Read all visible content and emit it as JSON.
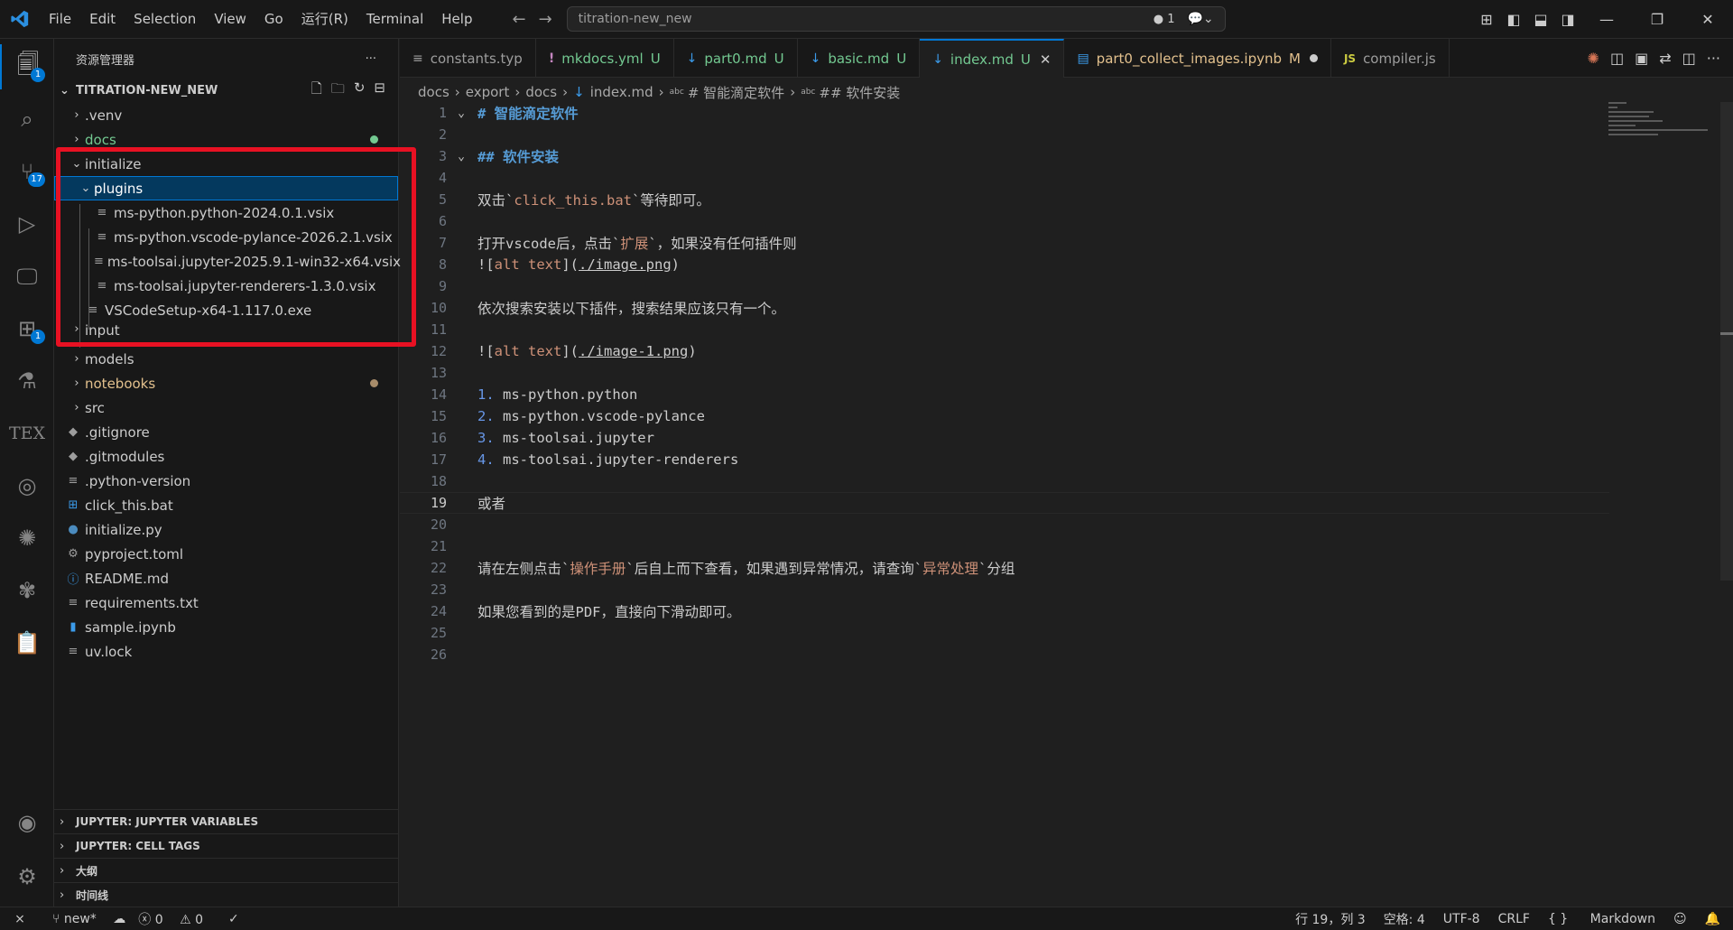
{
  "menu": [
    "File",
    "Edit",
    "Selection",
    "View",
    "Go",
    "运行(R)",
    "Terminal",
    "Help"
  ],
  "search": {
    "text": "titration-new_new",
    "count": "1"
  },
  "sidebar": {
    "title": "资源管理器",
    "root": "TITRATION-NEW_NEW",
    "items": [
      {
        "label": ".venv",
        "type": "folder"
      },
      {
        "label": "docs",
        "type": "folder"
      },
      {
        "label": "initialize",
        "type": "folder-open"
      },
      {
        "label": "plugins",
        "type": "folder-open"
      },
      {
        "label": "ms-python.python-2024.0.1.vsix",
        "type": "file"
      },
      {
        "label": "ms-python.vscode-pylance-2026.2.1.vsix",
        "type": "file"
      },
      {
        "label": "ms-toolsai.jupyter-2025.9.1-win32-x64.vsix",
        "type": "file"
      },
      {
        "label": "ms-toolsai.jupyter-renderers-1.3.0.vsix",
        "type": "file"
      },
      {
        "label": "VSCodeSetup-x64-1.117.0.exe",
        "type": "file"
      },
      {
        "label": "input",
        "type": "folder"
      },
      {
        "label": "models",
        "type": "folder"
      },
      {
        "label": "notebooks",
        "type": "folder"
      },
      {
        "label": "src",
        "type": "folder"
      },
      {
        "label": ".gitignore",
        "type": "file"
      },
      {
        "label": ".gitmodules",
        "type": "file"
      },
      {
        "label": ".python-version",
        "type": "file"
      },
      {
        "label": "click_this.bat",
        "type": "file"
      },
      {
        "label": "initialize.py",
        "type": "file"
      },
      {
        "label": "pyproject.toml",
        "type": "file"
      },
      {
        "label": "README.md",
        "type": "file"
      },
      {
        "label": "requirements.txt",
        "type": "file"
      },
      {
        "label": "sample.ipynb",
        "type": "file"
      },
      {
        "label": "uv.lock",
        "type": "file"
      }
    ],
    "panels": [
      "JUPYTER: JUPYTER VARIABLES",
      "JUPYTER: CELL TAGS",
      "大纲",
      "时间线"
    ]
  },
  "activity_badges": {
    "explorer": "1",
    "scm": "17",
    "extensions": "1"
  },
  "tabs": [
    {
      "label": "constants.typ",
      "icon": "≡",
      "suffix": ""
    },
    {
      "label": "mkdocs.yml",
      "icon": "!",
      "suffix": "U"
    },
    {
      "label": "part0.md",
      "icon": "↓",
      "suffix": "U"
    },
    {
      "label": "basic.md",
      "icon": "↓",
      "suffix": "U"
    },
    {
      "label": "index.md",
      "icon": "↓",
      "suffix": "U"
    },
    {
      "label": "part0_collect_images.ipynb",
      "icon": "▤",
      "suffix": "M"
    },
    {
      "label": "compiler.js",
      "icon": "JS",
      "suffix": ""
    }
  ],
  "breadcrumb": [
    "docs",
    "export",
    "docs",
    "index.md",
    "# 智能滴定软件",
    "## 软件安装"
  ],
  "editor": {
    "current_line": "19",
    "lines": [
      {
        "n": "1",
        "t": "# 智能滴定软件"
      },
      {
        "n": "2",
        "t": ""
      },
      {
        "n": "3",
        "t": "## 软件安装"
      },
      {
        "n": "4",
        "t": ""
      },
      {
        "n": "5",
        "t": "双击`click_this.bat`等待即可。"
      },
      {
        "n": "6",
        "t": ""
      },
      {
        "n": "7",
        "t": "打开vscode后，点击`扩展`，如果没有任何插件则"
      },
      {
        "n": "8",
        "t": "![alt text](./image.png)"
      },
      {
        "n": "9",
        "t": ""
      },
      {
        "n": "10",
        "t": "依次搜索安装以下插件，搜索结果应该只有一个。"
      },
      {
        "n": "11",
        "t": ""
      },
      {
        "n": "12",
        "t": "![alt text](./image-1.png)"
      },
      {
        "n": "13",
        "t": ""
      },
      {
        "n": "14",
        "t": "1. ms-python.python"
      },
      {
        "n": "15",
        "t": "2. ms-python.vscode-pylance"
      },
      {
        "n": "16",
        "t": "3. ms-toolsai.jupyter"
      },
      {
        "n": "17",
        "t": "4. ms-toolsai.jupyter-renderers"
      },
      {
        "n": "18",
        "t": ""
      },
      {
        "n": "19",
        "t": "或者"
      },
      {
        "n": "20",
        "t": ""
      },
      {
        "n": "21",
        "t": ""
      },
      {
        "n": "22",
        "t": "请在左侧点击`操作手册`后自上而下查看，如果遇到异常情况，请查询`异常处理`分组"
      },
      {
        "n": "23",
        "t": ""
      },
      {
        "n": "24",
        "t": "如果您看到的是PDF，直接向下滑动即可。"
      },
      {
        "n": "25",
        "t": ""
      },
      {
        "n": "26",
        "t": ""
      }
    ]
  },
  "status": {
    "branch": "new*",
    "errors": "0",
    "warnings": "0",
    "position": "行 19，列 3",
    "spaces": "空格: 4",
    "encoding": "UTF-8",
    "eol": "CRLF",
    "language": "Markdown"
  },
  "colors": {
    "accent": "#0078d4",
    "highlight": "#e81123",
    "untracked": "#73c991",
    "modified": "#e2c08d"
  }
}
